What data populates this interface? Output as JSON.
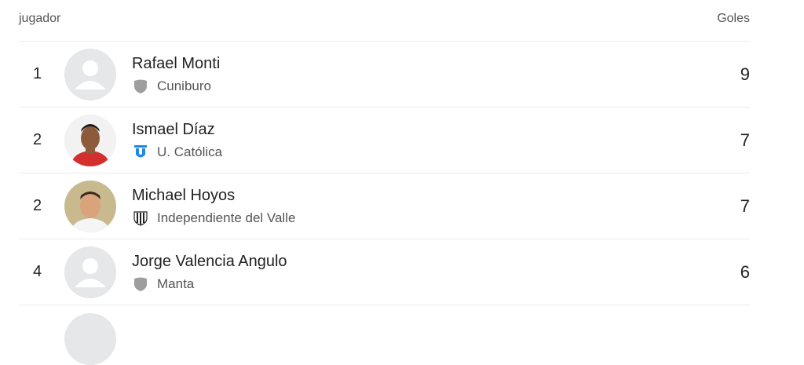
{
  "header": {
    "player_col": "jugador",
    "goals_col": "Goles"
  },
  "rows": [
    {
      "rank": "1",
      "name": "Rafael Monti",
      "team": "Cuniburo",
      "goals": "9",
      "avatar": "placeholder",
      "crest": "generic-shield-icon"
    },
    {
      "rank": "2",
      "name": "Ismael Díaz",
      "team": "U. Católica",
      "goals": "7",
      "avatar": "photo",
      "crest": "u-catolica-crest-icon"
    },
    {
      "rank": "2",
      "name": "Michael Hoyos",
      "team": "Independiente del Valle",
      "goals": "7",
      "avatar": "photo",
      "crest": "independiente-crest-icon"
    },
    {
      "rank": "4",
      "name": "Jorge Valencia Angulo",
      "team": "Manta",
      "goals": "6",
      "avatar": "placeholder",
      "crest": "generic-shield-icon"
    }
  ]
}
